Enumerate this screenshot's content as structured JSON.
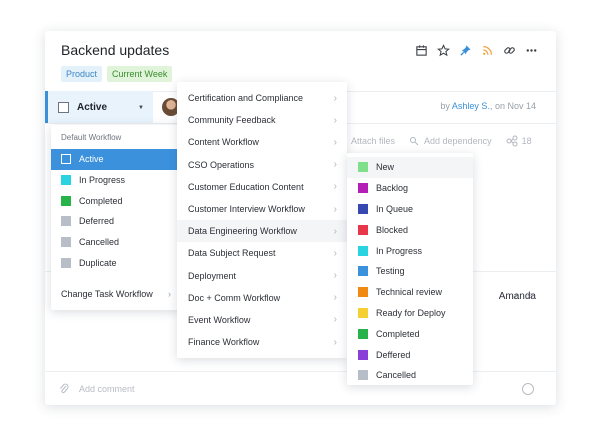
{
  "task": {
    "title": "Backend updates",
    "tags": [
      {
        "label": "Product",
        "style": "blue"
      },
      {
        "label": "Current Week",
        "style": "green"
      }
    ],
    "toolbar_icons": [
      "calendar-icon",
      "star-icon",
      "pin-icon",
      "rss-icon",
      "link-icon",
      "more-icon"
    ],
    "status": "Active",
    "by_prefix": "by",
    "author": "Ashley S.",
    "date_text": "on Nov 14",
    "attach_label": "Attach files",
    "dependency_label": "Add dependency",
    "subtask_count": "18",
    "assignee": "Amanda",
    "comment_placeholder": "Add comment"
  },
  "workflow_menu": {
    "header": "Default Workflow",
    "items": [
      {
        "label": "Active",
        "color": "#3b91dc",
        "selected": true
      },
      {
        "label": "In Progress",
        "color": "#29d4e0"
      },
      {
        "label": "Completed",
        "color": "#27b24a"
      },
      {
        "label": "Deferred",
        "color": "#b8bec7"
      },
      {
        "label": "Cancelled",
        "color": "#b8bec7"
      },
      {
        "label": "Duplicate",
        "color": "#b8bec7"
      }
    ],
    "change_label": "Change Task Workflow"
  },
  "workflow_list": [
    "Certification and Compliance",
    "Community Feedback",
    "Content Workflow",
    "CSO Operations",
    "Customer Education Content",
    "Customer Interview Workflow",
    "Data Engineering Workflow",
    "Data Subject Request",
    "Deployment",
    "Doc + Comm Workflow",
    "Event Workflow",
    "Finance Workflow"
  ],
  "highlighted_workflow": "Data Engineering Workflow",
  "status_list": [
    {
      "label": "New",
      "color": "#7ee08a"
    },
    {
      "label": "Backlog",
      "color": "#b51fb8"
    },
    {
      "label": "In Queue",
      "color": "#3748b0"
    },
    {
      "label": "Blocked",
      "color": "#e8364a"
    },
    {
      "label": "In Progress",
      "color": "#29d4e0"
    },
    {
      "label": "Testing",
      "color": "#3b91dc"
    },
    {
      "label": "Technical review",
      "color": "#f08a12"
    },
    {
      "label": "Ready for Deploy",
      "color": "#f5d033"
    },
    {
      "label": "Completed",
      "color": "#27b24a"
    },
    {
      "label": "Deffered",
      "color": "#8a3fd8"
    },
    {
      "label": "Cancelled",
      "color": "#b8bec7"
    }
  ]
}
